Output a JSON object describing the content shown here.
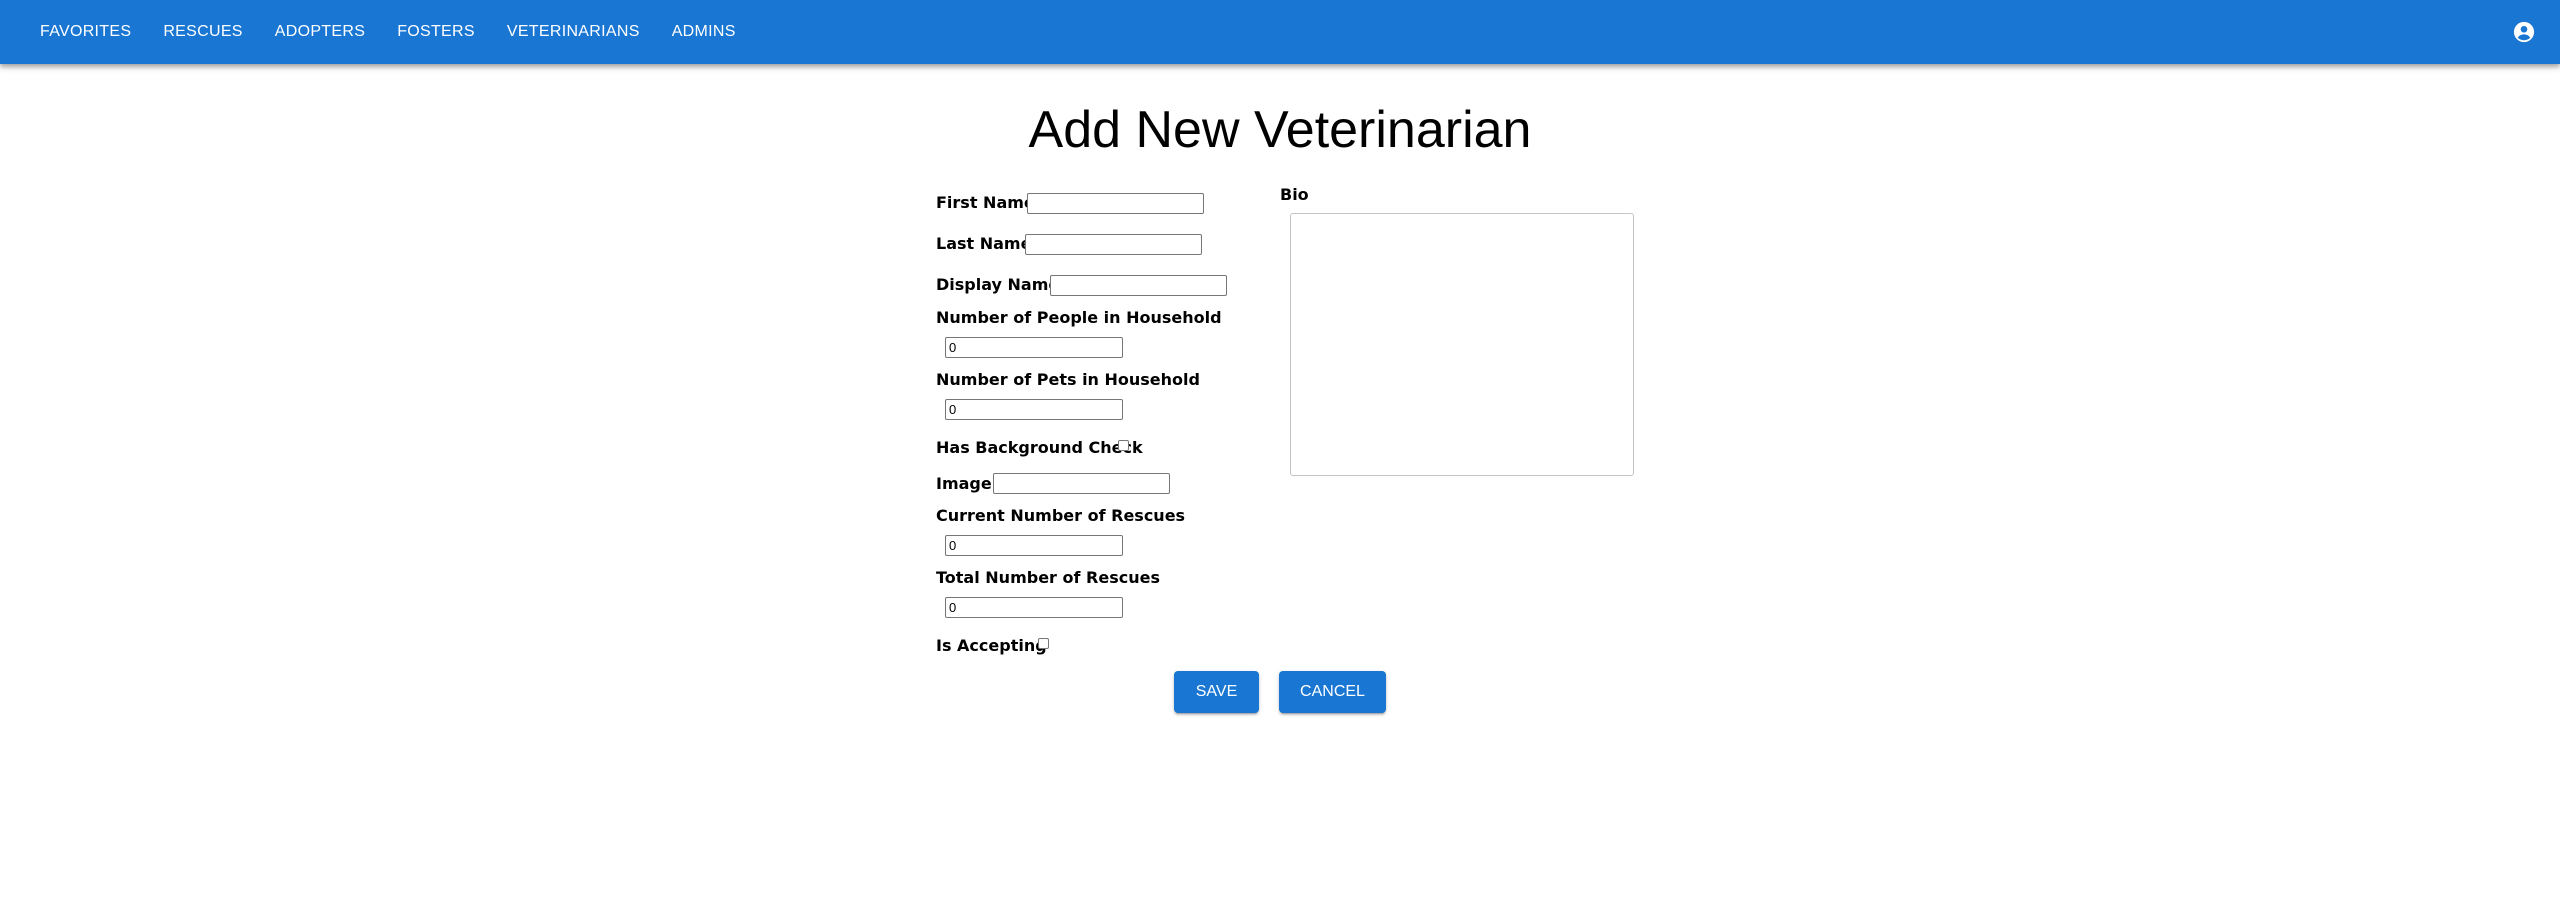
{
  "nav": {
    "items": [
      {
        "label": "FAVORITES"
      },
      {
        "label": "RESCUES"
      },
      {
        "label": "ADOPTERS"
      },
      {
        "label": "FOSTERS"
      },
      {
        "label": "VETERINARIANS"
      },
      {
        "label": "ADMINS"
      }
    ],
    "account_icon": "account-circle-icon"
  },
  "page": {
    "title": "Add New Veterinarian"
  },
  "form": {
    "first_name": {
      "label": "First Name",
      "value": ""
    },
    "last_name": {
      "label": "Last Name",
      "value": ""
    },
    "display_name": {
      "label": "Display Name",
      "value": ""
    },
    "people_in_household": {
      "label": "Number of People in Household",
      "value": "0"
    },
    "pets_in_household": {
      "label": "Number of Pets in Household",
      "value": "0"
    },
    "has_background_check": {
      "label": "Has Background Check",
      "checked": false
    },
    "image": {
      "label": "Image",
      "value": ""
    },
    "current_rescues": {
      "label": "Current Number of Rescues",
      "value": "0"
    },
    "total_rescues": {
      "label": "Total Number of Rescues",
      "value": "0"
    },
    "is_accepting": {
      "label": "Is Accepting",
      "checked": false
    },
    "bio": {
      "label": "Bio",
      "value": ""
    }
  },
  "actions": {
    "save_label": "SAVE",
    "cancel_label": "CANCEL"
  },
  "colors": {
    "primary": "#1976d2",
    "appbar_text": "#ffffff"
  }
}
